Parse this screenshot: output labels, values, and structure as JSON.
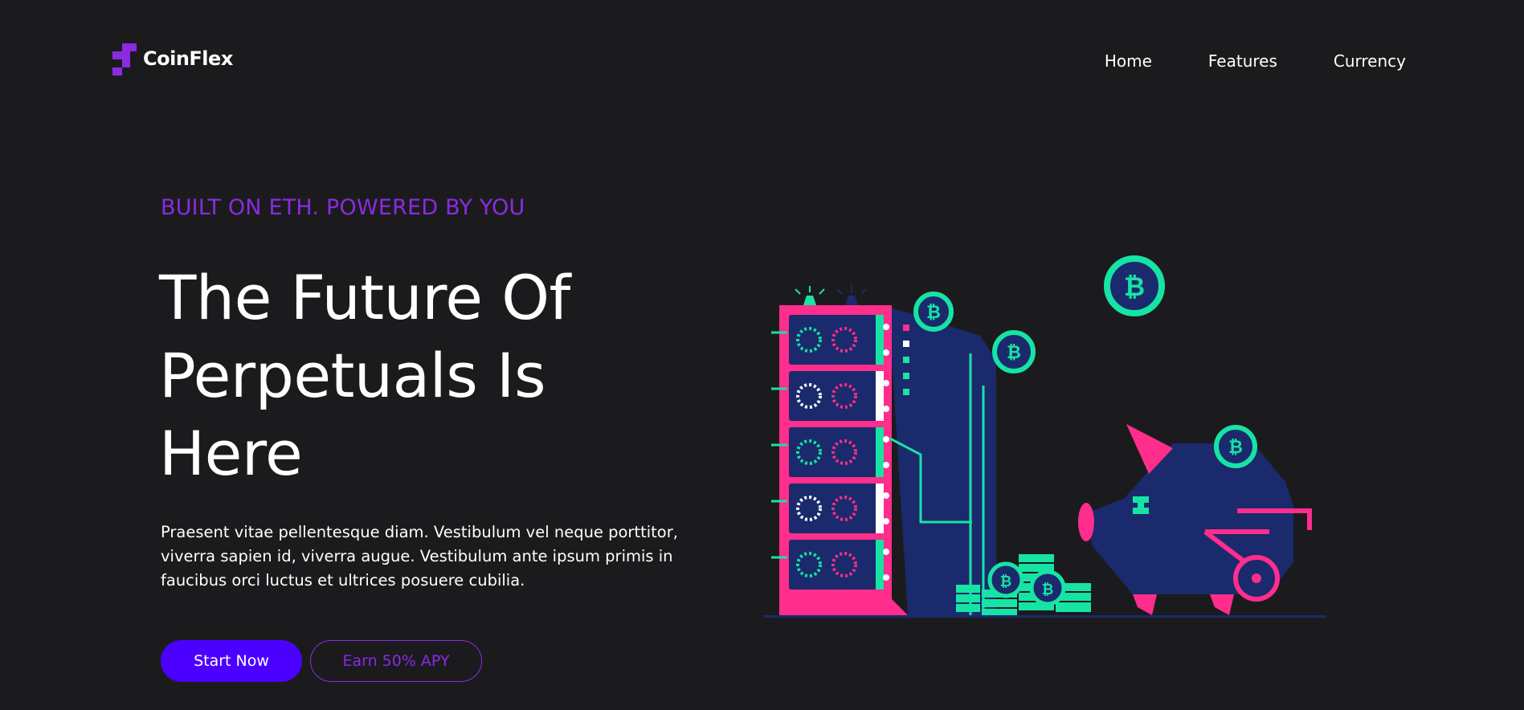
{
  "brand": {
    "name": "CoinFlex",
    "logo_icon": "pixel-blocks-logo",
    "logo_color": "#8a2be2"
  },
  "nav": {
    "items": [
      {
        "label": "Home"
      },
      {
        "label": "Features"
      },
      {
        "label": "Currency"
      }
    ]
  },
  "hero": {
    "eyebrow": "BUILT ON ETH. POWERED BY YOU",
    "headline": "The Future Of Perpetuals Is Here",
    "description": "Praesent vitae pellentesque diam. Vestibulum vel neque porttitor, viverra sapien id, viverra augue. Vestibulum ante ipsum primis in faucibus orci luctus et ultrices posuere cubilia.",
    "primary_button": "Start Now",
    "secondary_button": "Earn 50% APY"
  },
  "illustration": {
    "name": "crypto-mining-rig-and-piggy-bank",
    "icons": [
      "mining-rig-icon",
      "bitcoin-coin-icon",
      "coin-stack-icon",
      "piggy-bank-icon"
    ]
  },
  "colors": {
    "background": "#1b1b1e",
    "accent_purple": "#8a2be2",
    "button_blue": "#4c00ff",
    "pink": "#ff2d8c",
    "mint": "#17e3a5",
    "navy": "#1a2a6c"
  }
}
